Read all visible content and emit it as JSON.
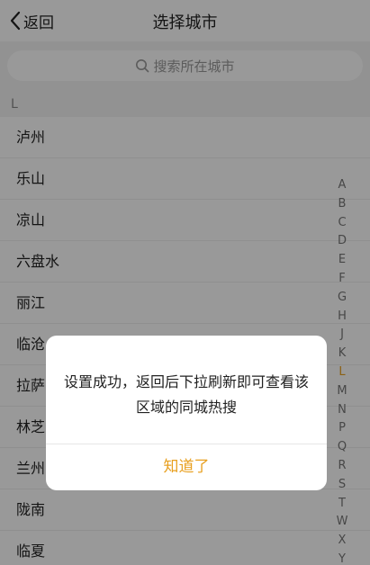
{
  "header": {
    "back_label": "返回",
    "title": "选择城市"
  },
  "search": {
    "placeholder": "搜索所在城市"
  },
  "section": {
    "letter": "L"
  },
  "cities": [
    "泸州",
    "乐山",
    "凉山",
    "六盘水",
    "丽江",
    "临沧",
    "拉萨",
    "林芝",
    "兰州",
    "陇南",
    "临夏"
  ],
  "index_letters": [
    "A",
    "B",
    "C",
    "D",
    "E",
    "F",
    "G",
    "H",
    "J",
    "K",
    "L",
    "M",
    "N",
    "P",
    "Q",
    "R",
    "S",
    "T",
    "W",
    "X",
    "Y"
  ],
  "active_index": "L",
  "dialog": {
    "message": "设置成功，返回后下拉刷新即可查看该区域的同城热搜",
    "button": "知道了"
  },
  "colors": {
    "accent": "#e8a020",
    "mask": "rgba(0,0,0,0.4)"
  }
}
